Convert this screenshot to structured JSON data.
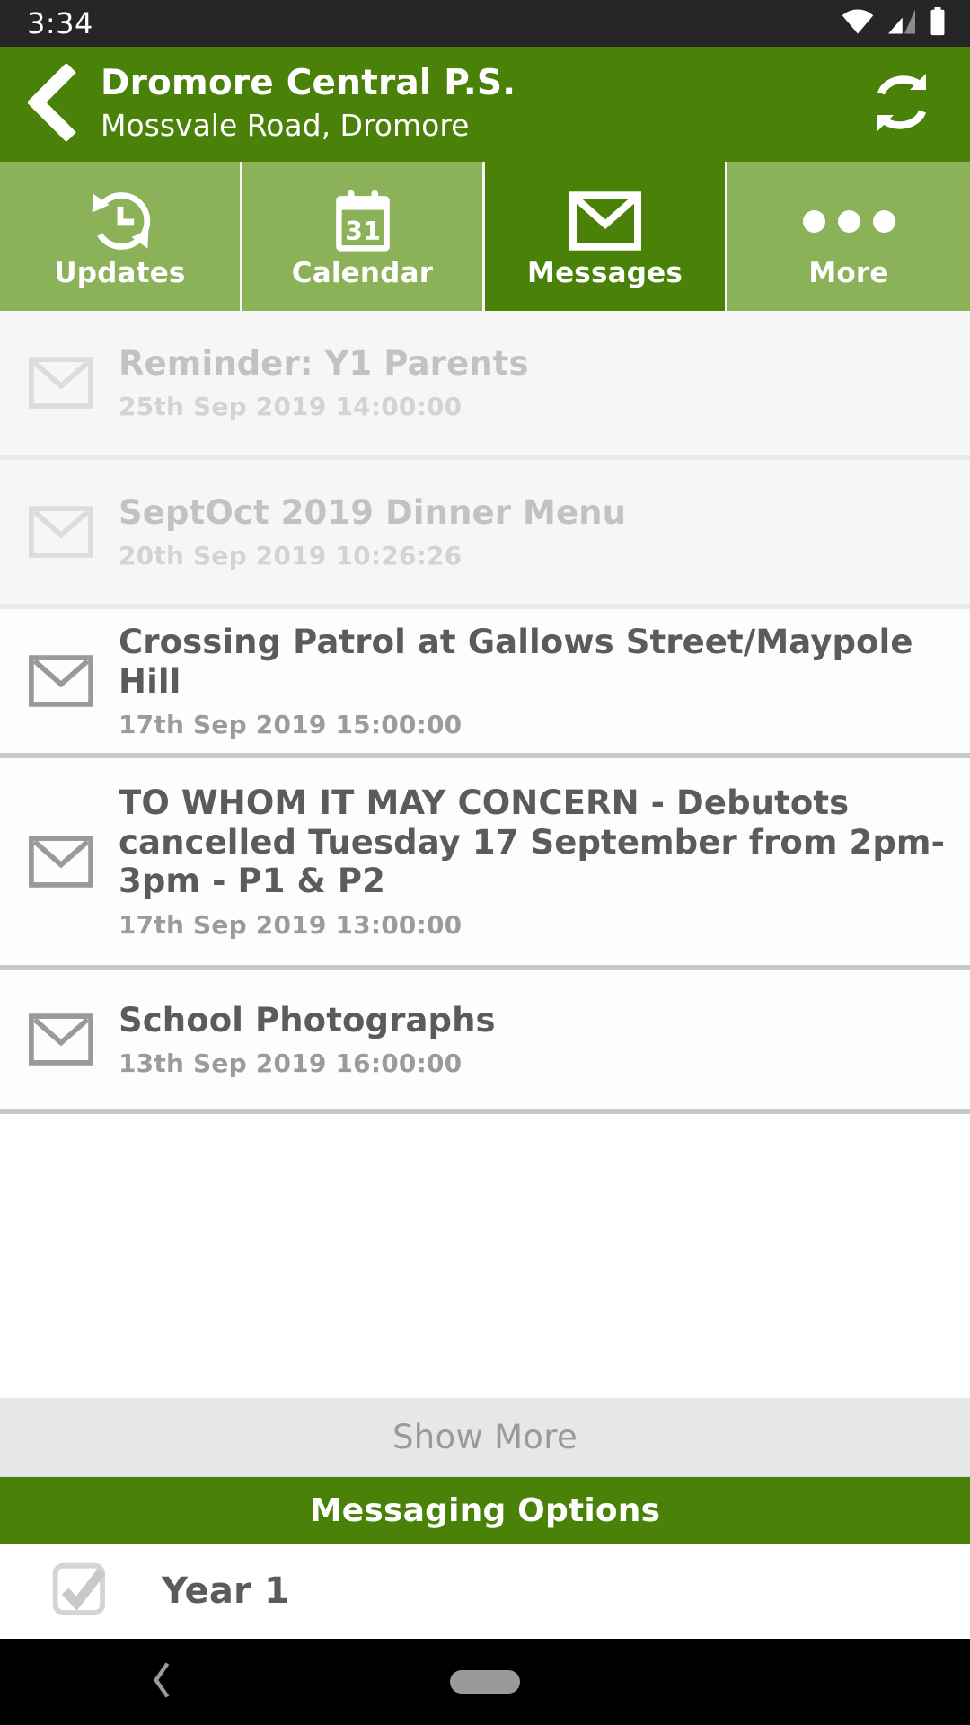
{
  "status_bar": {
    "time": "3:34",
    "icons": [
      "wifi-icon",
      "cellular-signal-icon",
      "battery-icon"
    ]
  },
  "header": {
    "back_icon": "back-chevron-icon",
    "school_name": "Dromore Central P.S.",
    "address": "Mossvale Road, Dromore",
    "refresh_icon": "refresh-icon",
    "background_color": "#4a8209",
    "text_color": "#ffffff"
  },
  "tabs": [
    {
      "label": "Updates",
      "icon": "history-clock-icon",
      "active": false
    },
    {
      "label": "Calendar",
      "icon": "calendar-31-icon",
      "active": false
    },
    {
      "label": "Messages",
      "icon": "envelope-icon",
      "active": true
    },
    {
      "label": "More",
      "icon": "ellipsis-icon",
      "active": false
    }
  ],
  "tab_colors": {
    "inactive": "#8bb259",
    "active": "#4a8209"
  },
  "messages": [
    {
      "icon": "envelope-icon",
      "title": "Reminder: Y1 Parents",
      "date": "25th Sep 2019 14:00:00",
      "read": true
    },
    {
      "icon": "envelope-icon",
      "title": "SeptOct 2019 Dinner Menu",
      "date": "20th Sep 2019 10:26:26",
      "read": true
    },
    {
      "icon": "envelope-icon",
      "title": "Crossing Patrol at Gallows Street/Maypole Hill",
      "date": "17th Sep 2019 15:00:00",
      "read": false
    },
    {
      "icon": "envelope-icon",
      "title": "TO WHOM IT MAY CONCERN - Debutots cancelled Tuesday 17 September from 2pm-3pm - P1 & P2",
      "date": "17th Sep 2019 13:00:00",
      "read": false
    },
    {
      "icon": "envelope-icon",
      "title": "School Photographs",
      "date": "13th Sep 2019 16:00:00",
      "read": false
    }
  ],
  "show_more": {
    "label": "Show More"
  },
  "messaging_options": {
    "header": "Messaging Options",
    "options": [
      {
        "label": "Year 1",
        "checked": true,
        "icon": "checkbox-checked-icon"
      }
    ]
  },
  "nav_bar": {
    "back_icon": "nav-back-icon",
    "home_icon": "home-pill-icon"
  }
}
